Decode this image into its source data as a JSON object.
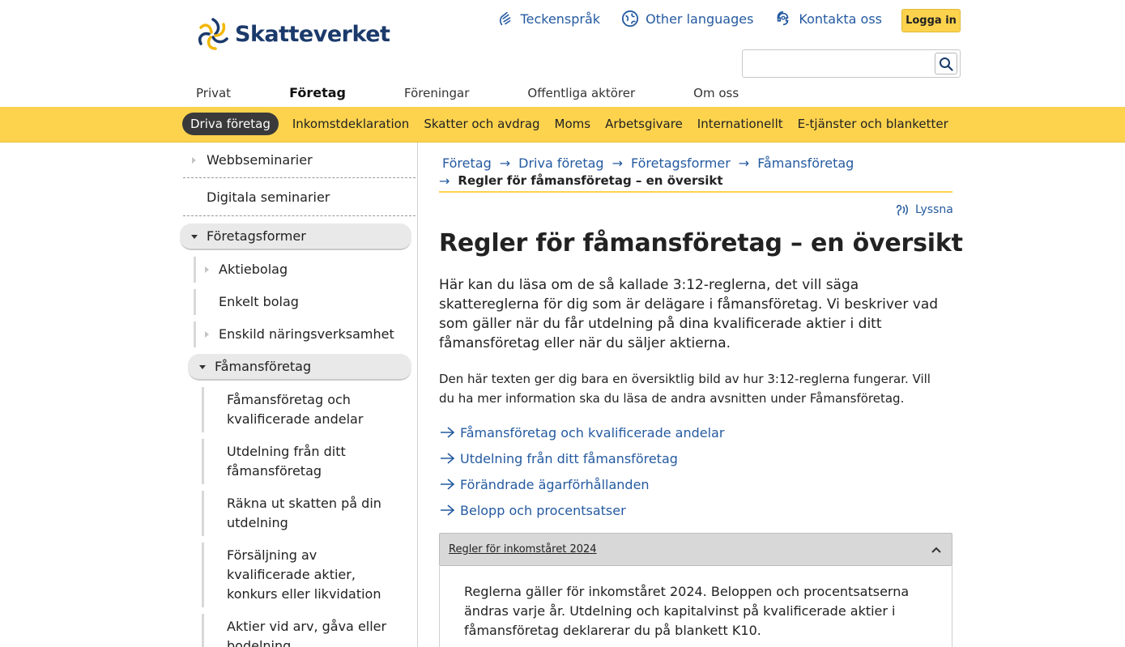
{
  "brand": {
    "name": "Skatteverket"
  },
  "header": {
    "links": [
      {
        "label": "Teckenspråk",
        "icon": "sign-language-icon"
      },
      {
        "label": "Other languages",
        "icon": "globe-icon"
      },
      {
        "label": "Kontakta oss",
        "icon": "contact-icon"
      }
    ],
    "login_label": "Logga in",
    "search": {
      "placeholder": "",
      "value": ""
    }
  },
  "tabs": [
    {
      "label": "Privat",
      "active": false
    },
    {
      "label": "Företag",
      "active": true
    },
    {
      "label": "Föreningar",
      "active": false
    },
    {
      "label": "Offentliga aktörer",
      "active": false
    },
    {
      "label": "Om oss",
      "active": false
    }
  ],
  "subnav": [
    {
      "label": "Driva företag",
      "active": true
    },
    {
      "label": "Inkomstdeklaration"
    },
    {
      "label": "Skatter och avdrag"
    },
    {
      "label": "Moms"
    },
    {
      "label": "Arbetsgivare"
    },
    {
      "label": "Internationellt"
    },
    {
      "label": "E-tjänster och blanketter"
    }
  ],
  "sidebar": {
    "items": [
      {
        "label": "Webbseminarier"
      },
      {
        "label": "Digitala seminarier"
      },
      {
        "label": "Företagsformer"
      },
      {
        "label": "Aktiebolag"
      },
      {
        "label": "Enkelt bolag"
      },
      {
        "label": "Enskild näringsverksamhet"
      },
      {
        "label": "Fåmansföretag"
      },
      {
        "label": "Fåmansföretag och kvalificerade andelar"
      },
      {
        "label": "Utdelning från ditt fåmansföretag"
      },
      {
        "label": "Räkna ut skatten på din utdelning"
      },
      {
        "label": "Försäljning av kvalificerade aktier, konkurs eller likvidation"
      },
      {
        "label": "Aktier vid arv, gåva eller bodelning"
      }
    ]
  },
  "breadcrumb": {
    "items": [
      "Företag",
      "Driva företag",
      "Företagsformer",
      "Fåmansföretag"
    ],
    "current": "Regler för fåmansföretag – en översikt"
  },
  "listen_label": "Lyssna",
  "main": {
    "title": "Regler för fåmansföretag – en översikt",
    "lead": "Här kan du läsa om de så kallade 3:12-reglerna, det vill säga skattereglerna för dig som är delägare i fåmansföretag. Vi beskriver vad som gäller när du får utdelning på dina kvalificerade aktier i ditt fåmansföretag eller när du säljer aktierna.",
    "body": "Den här texten ger dig bara en översiktlig bild av hur 3:12-reglerna fungerar. Vill du ha mer information ska du läsa de andra avsnitten under Fåmansföretag.",
    "links": [
      "Fåmansföretag och kvalificerade andelar",
      "Utdelning från ditt fåmansföretag",
      "Förändrade ägarförhållanden",
      "Belopp och procentsatser"
    ],
    "accordion": {
      "title": "Regler för inkomståret 2024",
      "body": "Reglerna gäller för inkomståret 2024. Beloppen och procentsatserna ändras varje år. Utdelning och kapitalvinst på kvalificerade aktier i fåmansföretag deklarerar du på blankett K10."
    }
  },
  "colors": {
    "yellow": "#fdd34d",
    "link": "#245aa0",
    "navy": "#1b3a6b"
  }
}
